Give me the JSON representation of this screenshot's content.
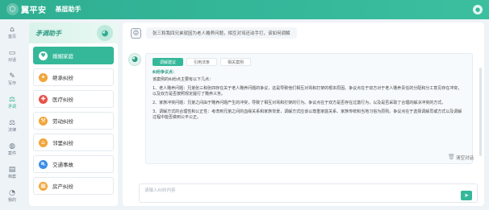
{
  "header": {
    "logo_mark": "⬡",
    "logo_text": "翼平安",
    "subtitle": "基层助手"
  },
  "rail": {
    "items": [
      {
        "label": "首页",
        "icon": "home-icon",
        "glyph": "⌂"
      },
      {
        "label": "对话",
        "icon": "chat-icon",
        "glyph": "▭"
      },
      {
        "label": "写作",
        "icon": "pen-icon",
        "glyph": "✎"
      },
      {
        "label": "矛调",
        "icon": "balance-icon",
        "glyph": "⚖"
      },
      {
        "label": "法律",
        "icon": "scale-icon",
        "glyph": "⚖"
      },
      {
        "label": "案件",
        "icon": "globe-icon",
        "glyph": "◍"
      },
      {
        "label": "档案",
        "icon": "archive-icon",
        "glyph": "▤"
      },
      {
        "label": "我的",
        "icon": "user-icon",
        "glyph": "◔"
      }
    ]
  },
  "categories": {
    "title": "矛调助手",
    "items": [
      {
        "label": "婚姻家庭",
        "color": "#35b89a",
        "glyph": "♥"
      },
      {
        "label": "继承纠纷",
        "color": "#f2a53a",
        "glyph": "✦"
      },
      {
        "label": "医疗纠纷",
        "color": "#e8534a",
        "glyph": "✚"
      },
      {
        "label": "劳动纠纷",
        "color": "#f2a53a",
        "glyph": "⚒"
      },
      {
        "label": "邻里纠纷",
        "color": "#f2a53a",
        "glyph": "⌂"
      },
      {
        "label": "交通事故",
        "color": "#3a8ee8",
        "glyph": "⛐"
      },
      {
        "label": "房产纠纷",
        "color": "#f2a53a",
        "glyph": "▦"
      }
    ]
  },
  "chat": {
    "question": "张三和我四兄弟就因为老人赡养问题，相互对骂还动手打，该如何调解",
    "tabs": [
      "调解建议",
      "引用法条",
      "相关案例"
    ],
    "heading": "纠纷争议点：",
    "intro": "该案例的纠纷点主要有以下几点：",
    "points": [
      "1、老人赡养问题：兄弟张三和张四存在关于老人赡养问题的争议，这是导致他们相互对骂和打架的根本原因。争议点在于双方对于老人赡养责任的分配和分工意见存在冲突，以及双方是否按照规定履行了赡养义务。",
      "2、家族冲突问题：兄弟之间由于赡养问题产生的冲突，导致了相互对骂和打架的行为。争议点在于双方是否存在过激行为，以及是否采取了合理的解决冲突的方式。",
      "3、调解方式的合理性和公正性：考虑到兄弟之间的血缘关系和家族背景，调解方式应该以尊重家庭关系、家族传统和当地习俗为原则。争议点在于选择调解员或方式以及调解过程中能否做到公平公正。"
    ],
    "clear_label": "清空对话",
    "input_placeholder": "请输入纠纷内容"
  }
}
